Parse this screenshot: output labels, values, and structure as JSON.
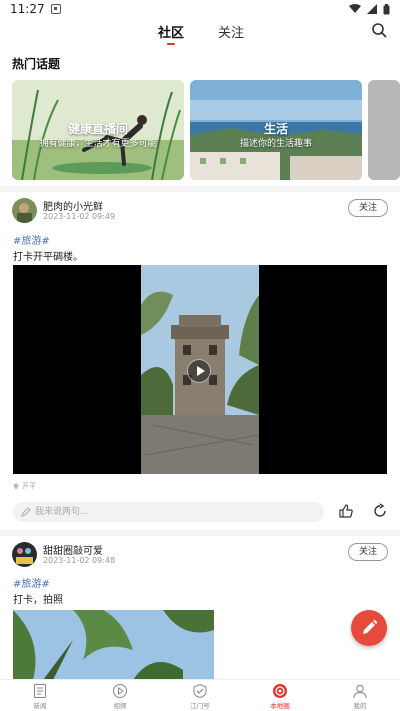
{
  "status_bar": {
    "time": "11:27"
  },
  "top_nav": {
    "tabs": [
      {
        "label": "社区",
        "active": true
      },
      {
        "label": "关注",
        "active": false
      }
    ]
  },
  "hot_topics": {
    "title": "热门话题",
    "cards": [
      {
        "title": "健康直播间",
        "subtitle": "拥有健康，生活才有更多可能"
      },
      {
        "title": "生活",
        "subtitle": "描述你的生活趣事"
      }
    ]
  },
  "posts": [
    {
      "author": "肥肉的小光鲜",
      "time": "2023-11-02 09:49",
      "follow_label": "关注",
      "hashtag": "#旅游#",
      "text": "打卡开平碉楼。",
      "location": "开平",
      "comment_placeholder": "我来说两句..."
    },
    {
      "author": "甜甜圈敲可爱",
      "time": "2023-11-02 09:48",
      "follow_label": "关注",
      "hashtag": "#旅游#",
      "text": "打卡，拍照"
    }
  ],
  "bottom_nav": {
    "items": [
      {
        "label": "新闻",
        "icon": "news-icon"
      },
      {
        "label": "视频",
        "icon": "video-icon"
      },
      {
        "label": "江门号",
        "icon": "check-circle-icon"
      },
      {
        "label": "本地圈",
        "icon": "target-icon",
        "active": true
      },
      {
        "label": "我的",
        "icon": "person-icon"
      }
    ]
  },
  "colors": {
    "accent": "#e5322d",
    "hashtag": "#4a73b8",
    "fab": "#e64a3c"
  }
}
